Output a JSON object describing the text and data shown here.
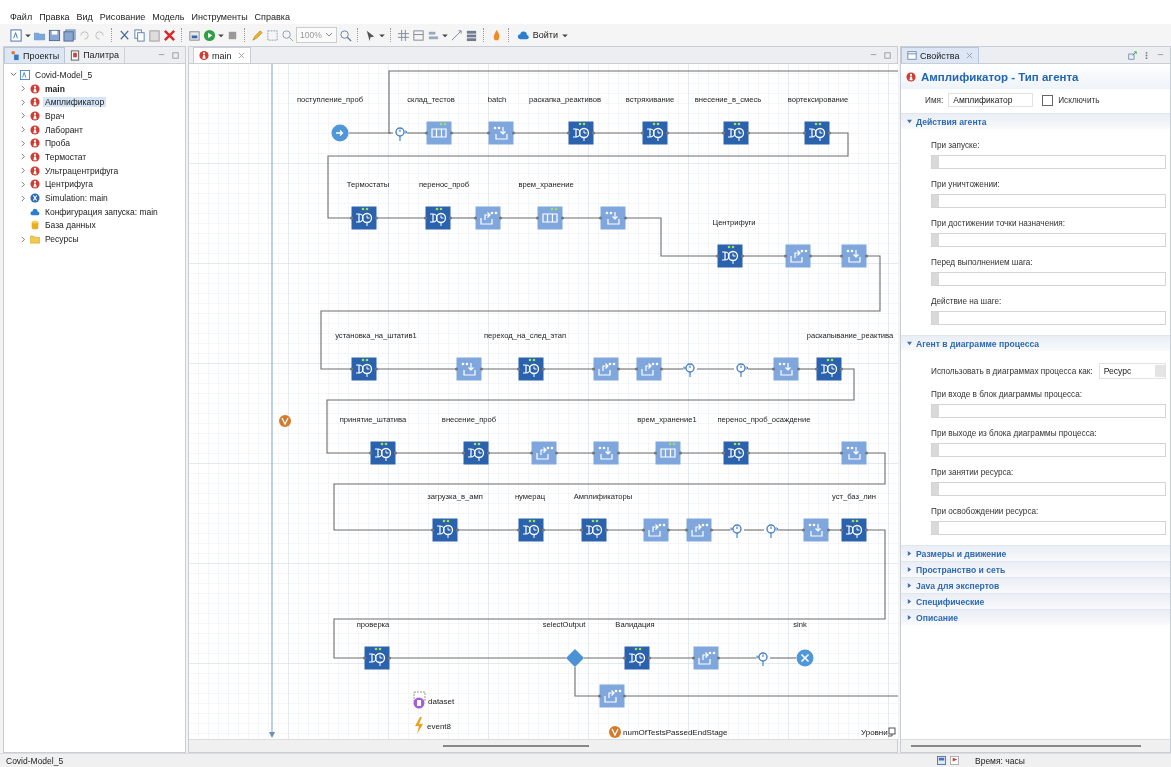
{
  "menu": [
    "Файл",
    "Правка",
    "Вид",
    "Рисование",
    "Модель",
    "Инструменты",
    "Справка"
  ],
  "toolbar": {
    "zoom": "100%",
    "login": "Войти"
  },
  "left_panel": {
    "tabs": [
      {
        "label": "Проекты",
        "selected": true
      },
      {
        "label": "Палитра",
        "selected": false
      }
    ],
    "tree": {
      "label": "Covid-Model_5",
      "kind": "model",
      "expanded": true,
      "children": [
        {
          "label": "main",
          "kind": "agent",
          "active": true,
          "selected": false,
          "expandable": true
        },
        {
          "label": "Амплификатор",
          "kind": "agent",
          "active": false,
          "selected": true,
          "expandable": true
        },
        {
          "label": "Врач",
          "kind": "agent",
          "active": false,
          "selected": false,
          "expandable": true
        },
        {
          "label": "Лаборант",
          "kind": "agent",
          "active": false,
          "selected": false,
          "expandable": true
        },
        {
          "label": "Проба",
          "kind": "agent",
          "active": false,
          "selected": false,
          "expandable": true
        },
        {
          "label": "Термостат",
          "kind": "agent",
          "active": false,
          "selected": false,
          "expandable": true
        },
        {
          "label": "Ультрацентрифуга",
          "kind": "agent",
          "active": false,
          "selected": false,
          "expandable": true
        },
        {
          "label": "Центрифуга",
          "kind": "agent",
          "active": false,
          "selected": false,
          "expandable": true
        },
        {
          "label": "Simulation: main",
          "kind": "experiment",
          "active": false,
          "selected": false,
          "expandable": true
        },
        {
          "label": "Конфигурация запуска: main",
          "kind": "run-config",
          "active": false,
          "selected": false,
          "expandable": false
        },
        {
          "label": "База данных",
          "kind": "database",
          "active": false,
          "selected": false,
          "expandable": false
        },
        {
          "label": "Ресурсы",
          "kind": "folder",
          "active": false,
          "selected": false,
          "expandable": true
        }
      ]
    }
  },
  "editor": {
    "tab": "main",
    "diagram": {
      "rows": [
        {
          "nodes": [
            {
              "kind": "source",
              "label": "поступление_проб"
            },
            {
              "kind": "time-start"
            },
            {
              "kind": "queue",
              "label": "склад_тестов"
            },
            {
              "kind": "combine",
              "label": "batch"
            },
            {
              "kind": "service",
              "label": "раскапка_реактивов"
            },
            {
              "kind": "service",
              "label": "встряхивание"
            },
            {
              "kind": "service",
              "label": "внесение_в_смесь"
            },
            {
              "kind": "service",
              "label": "вортексирование"
            }
          ]
        },
        {
          "nodes": [
            {
              "kind": "service",
              "label": "Термостаты"
            },
            {
              "kind": "service",
              "label": "перенос_проб"
            },
            {
              "kind": "split"
            },
            {
              "kind": "queue",
              "label": "врем_хранение"
            },
            {
              "kind": "combine"
            }
          ]
        },
        {
          "nodes": [
            {
              "kind": "service",
              "label": "Центрифуги"
            },
            {
              "kind": "split"
            },
            {
              "kind": "combine"
            }
          ]
        },
        {
          "nodes": [
            {
              "kind": "service",
              "label": "установка_на_штатив1"
            },
            {
              "kind": "combine"
            },
            {
              "kind": "service",
              "label": "переход_на_след_этап"
            },
            {
              "kind": "split"
            },
            {
              "kind": "split"
            },
            {
              "kind": "time-end"
            },
            {
              "kind": "time-start"
            },
            {
              "kind": "combine"
            },
            {
              "kind": "service",
              "label": "раскапывание_реактива"
            }
          ]
        },
        {
          "nodes": [
            {
              "kind": "service",
              "label": "принятие_штатива"
            },
            {
              "kind": "service",
              "label": "внесение_проб"
            },
            {
              "kind": "split"
            },
            {
              "kind": "combine"
            },
            {
              "kind": "queue",
              "label": "врем_хранение1"
            },
            {
              "kind": "service",
              "label": "перенос_проб_осаждение"
            },
            {
              "kind": "combine"
            }
          ]
        },
        {
          "nodes": [
            {
              "kind": "service",
              "label": "загрузка_в_амп"
            },
            {
              "kind": "service",
              "label": "нумерац"
            },
            {
              "kind": "service",
              "label": "Амплификаторы"
            },
            {
              "kind": "split"
            },
            {
              "kind": "split"
            },
            {
              "kind": "time-end"
            },
            {
              "kind": "time-start"
            },
            {
              "kind": "combine"
            },
            {
              "kind": "service",
              "label": "уст_баз_лин"
            }
          ]
        },
        {
          "nodes": [
            {
              "kind": "service",
              "label": "проверка"
            },
            {
              "kind": "select",
              "label": "selectOutput"
            },
            {
              "kind": "service",
              "label": "Валидация"
            },
            {
              "kind": "split"
            },
            {
              "kind": "time-end"
            },
            {
              "kind": "sink",
              "label": "sink"
            }
          ]
        },
        {
          "nodes": [
            {
              "kind": "split"
            }
          ]
        }
      ],
      "items": [
        {
          "kind": "variable"
        },
        {
          "kind": "dataset",
          "label": "dataset"
        },
        {
          "kind": "event",
          "label": "event8"
        },
        {
          "kind": "variable",
          "label": "numOfTestsPassedEndStage"
        }
      ],
      "levels_button": "Уровни"
    }
  },
  "properties": {
    "tab": "Свойства",
    "title": "Амплификатор - Тип агента",
    "name_label": "Имя:",
    "name_value": "Амплификатор",
    "exclude": {
      "label": "Исключить",
      "checked": false
    },
    "sections": [
      {
        "title": "Действия агента",
        "expanded": true,
        "fields": [
          {
            "kind": "code",
            "label": "При запуске:"
          },
          {
            "kind": "code",
            "label": "При уничтожении:"
          },
          {
            "kind": "code",
            "label": "При достижении точки назначения:"
          },
          {
            "kind": "code",
            "label": "Перед выполнением шага:"
          },
          {
            "kind": "code",
            "label": "Действие на шаге:"
          }
        ]
      },
      {
        "title": "Агент в диаграмме процесса",
        "expanded": true,
        "fields": [
          {
            "kind": "select",
            "label": "Использовать в диаграммах процесса как:",
            "value": "Ресурс"
          },
          {
            "kind": "code",
            "label": "При входе в блок диаграммы процесса:"
          },
          {
            "kind": "code",
            "label": "При выходе из блока диаграммы процесса:"
          },
          {
            "kind": "code",
            "label": "При занятии ресурса:"
          },
          {
            "kind": "code",
            "label": "При освобождении ресурса:"
          }
        ]
      },
      {
        "title": "Размеры и движение",
        "expanded": false
      },
      {
        "title": "Пространство и сеть",
        "expanded": false
      },
      {
        "title": "Java для экспертов",
        "expanded": false
      },
      {
        "title": "Специфические",
        "expanded": false
      },
      {
        "title": "Описание",
        "expanded": false
      }
    ]
  },
  "status_bar": {
    "model": "Covid-Model_5",
    "time_units": "Время: часы"
  }
}
